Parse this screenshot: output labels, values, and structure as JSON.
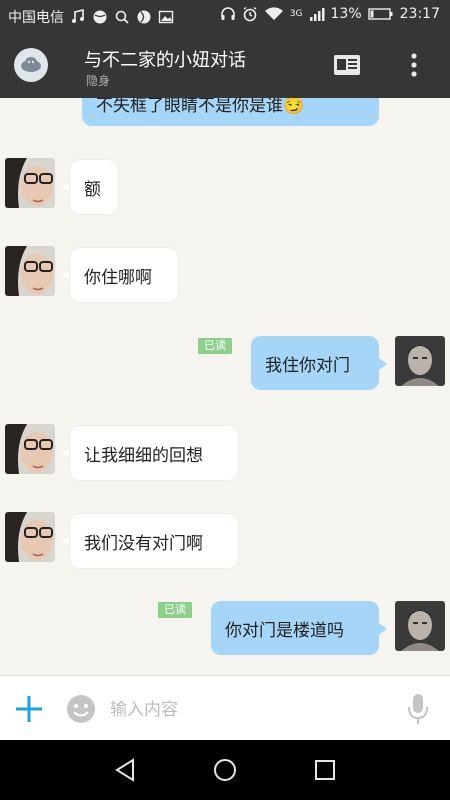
{
  "status_bar": {
    "carrier": "中国电信",
    "network": "3G",
    "battery": "13%",
    "time": "23:17"
  },
  "header": {
    "title": "与不二家的小妞对话",
    "subtitle": "隐身"
  },
  "messages": [
    {
      "side": "out",
      "text": "不失框了眼睛不是你是谁😏"
    },
    {
      "side": "in",
      "text": "额"
    },
    {
      "side": "in",
      "text": "你住哪啊"
    },
    {
      "side": "out",
      "text": "我住你对门",
      "read_label": "已读"
    },
    {
      "side": "in",
      "text": "让我细细的回想"
    },
    {
      "side": "in",
      "text": "我们没有对门啊"
    },
    {
      "side": "out",
      "text": "你对门是楼道吗",
      "read_label": "已读"
    }
  ],
  "input": {
    "placeholder": "输入内容",
    "value": ""
  },
  "colors": {
    "accent": "#1aa2e0",
    "outgoing_bubble": "#a5d6f7",
    "read_badge": "#8ed08b",
    "header_bg": "#363636"
  }
}
